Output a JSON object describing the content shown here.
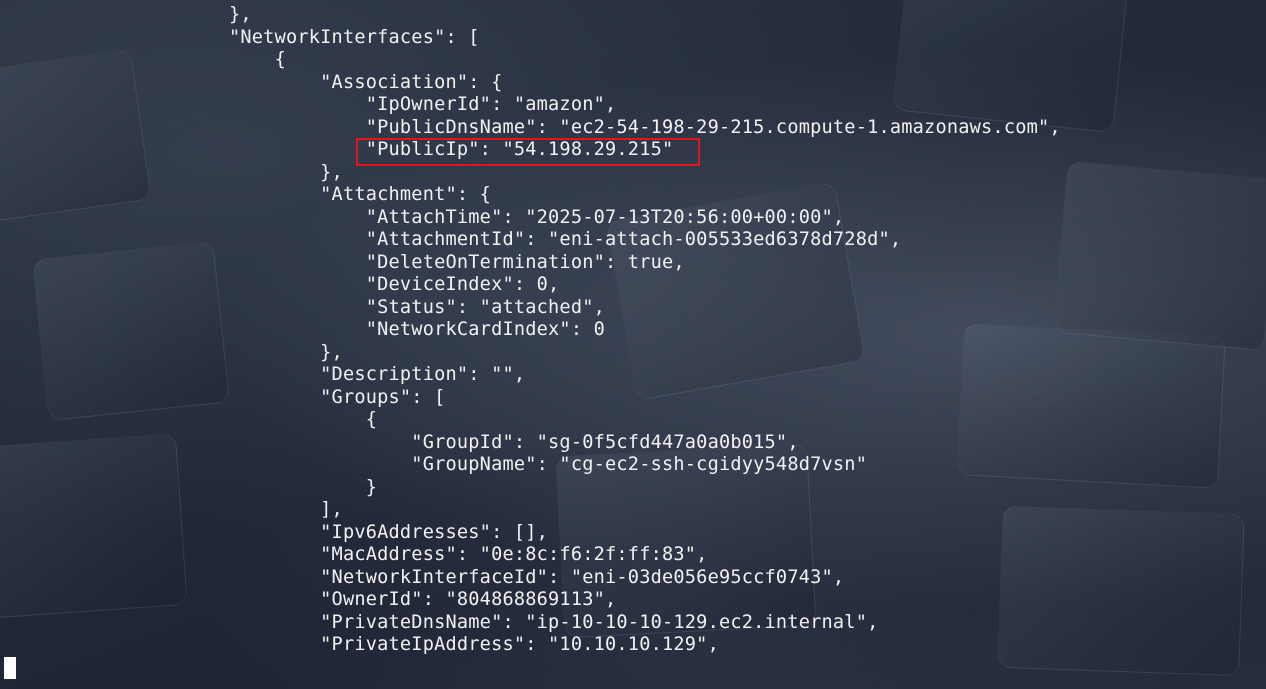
{
  "terminal": {
    "lines": [
      "},",
      "\"NetworkInterfaces\": [",
      "    {",
      "        \"Association\": {",
      "            \"IpOwnerId\": \"amazon\",",
      "            \"PublicDnsName\": \"ec2-54-198-29-215.compute-1.amazonaws.com\",",
      "            \"PublicIp\": \"54.198.29.215\"",
      "        },",
      "        \"Attachment\": {",
      "            \"AttachTime\": \"2025-07-13T20:56:00+00:00\",",
      "            \"AttachmentId\": \"eni-attach-005533ed6378d728d\",",
      "            \"DeleteOnTermination\": true,",
      "            \"DeviceIndex\": 0,",
      "            \"Status\": \"attached\",",
      "            \"NetworkCardIndex\": 0",
      "        },",
      "        \"Description\": \"\",",
      "        \"Groups\": [",
      "            {",
      "                \"GroupId\": \"sg-0f5cfd447a0a0b015\",",
      "                \"GroupName\": \"cg-ec2-ssh-cgidyy548d7vsn\"",
      "            }",
      "        ],",
      "        \"Ipv6Addresses\": [],",
      "        \"MacAddress\": \"0e:8c:f6:2f:ff:83\",",
      "        \"NetworkInterfaceId\": \"eni-03de056e95ccf0743\",",
      "        \"OwnerId\": \"804868869113\",",
      "        \"PrivateDnsName\": \"ip-10-10-10-129.ec2.internal\",",
      "        \"PrivateIpAddress\": \"10.10.10.129\","
    ],
    "highlighted_line": "\"PublicIp\": \"54.198.29.215\"",
    "highlight_color": "#e0161b",
    "text_color": "#f2f2f2",
    "background_color": "#1f2636"
  }
}
